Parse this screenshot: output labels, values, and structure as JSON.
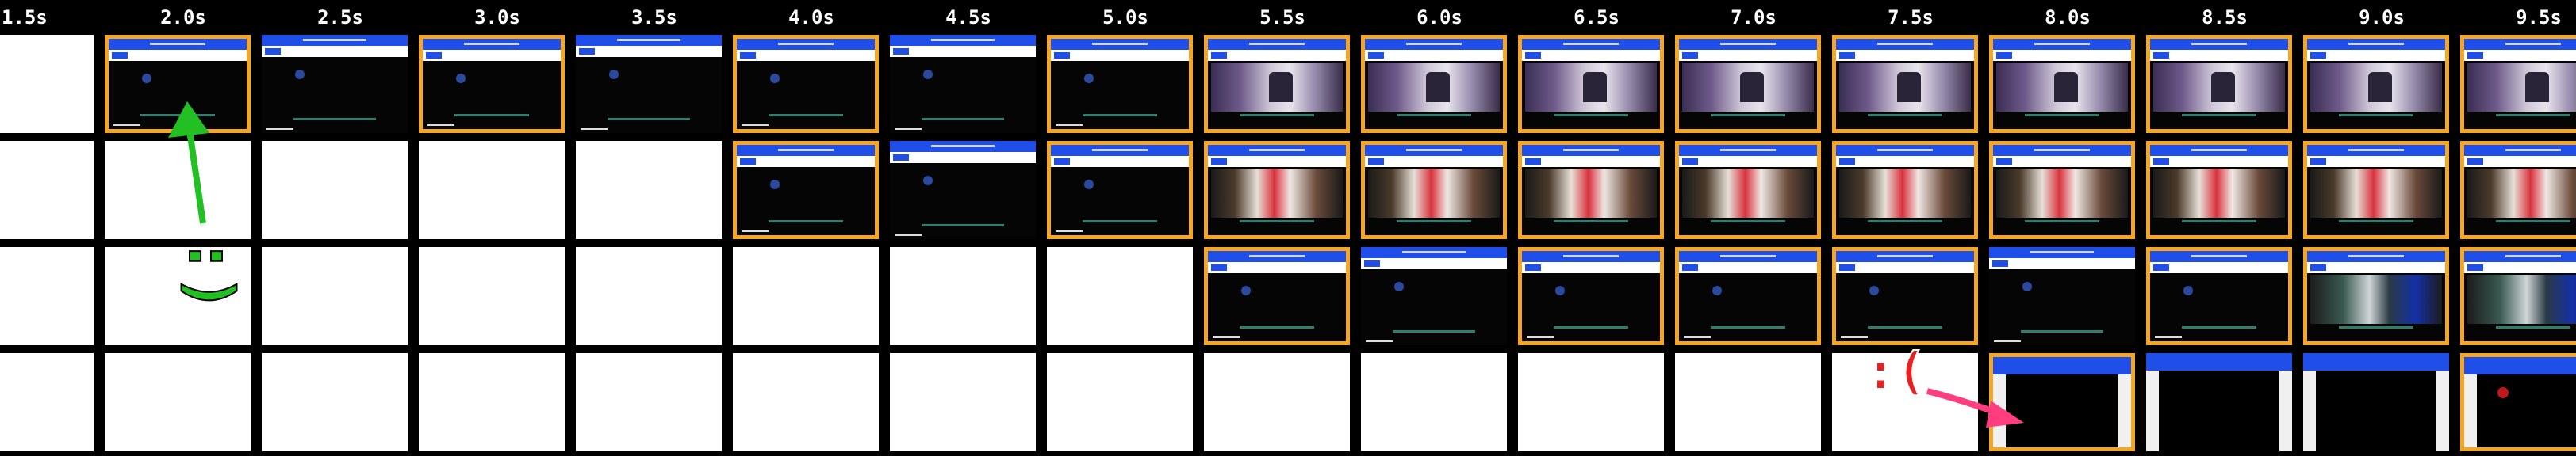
{
  "time_labels": [
    "1.5s",
    "2.0s",
    "2.5s",
    "3.0s",
    "3.5s",
    "4.0s",
    "4.5s",
    "5.0s",
    "5.5s",
    "6.0s",
    "6.5s",
    "7.0s",
    "7.5s",
    "8.0s",
    "8.5s",
    "9.0s",
    "9.5s"
  ],
  "rows": [
    {
      "name": "row-1",
      "frames": [
        "blank",
        "dark",
        "dark",
        "dark",
        "dark",
        "dark",
        "dark",
        "dark",
        "video",
        "video",
        "video",
        "video",
        "video",
        "video",
        "video",
        "video",
        "video"
      ],
      "changed": [
        false,
        true,
        false,
        true,
        false,
        true,
        false,
        true,
        true,
        true,
        true,
        true,
        true,
        true,
        true,
        true,
        true
      ]
    },
    {
      "name": "row-2",
      "frames": [
        "blank",
        "blank",
        "blank",
        "blank",
        "blank",
        "dark",
        "dark",
        "dark",
        "colorful",
        "colorful",
        "colorful",
        "colorful",
        "colorful",
        "colorful",
        "colorful",
        "colorful",
        "colorful"
      ],
      "changed": [
        false,
        false,
        false,
        false,
        false,
        true,
        false,
        true,
        true,
        true,
        true,
        true,
        true,
        true,
        true,
        true,
        true
      ]
    },
    {
      "name": "row-3",
      "frames": [
        "blank",
        "blank",
        "blank",
        "blank",
        "blank",
        "blank",
        "blank",
        "blank",
        "dark",
        "dark",
        "dark",
        "dark",
        "dark",
        "dark",
        "dark",
        "gallery",
        "gallery"
      ],
      "changed": [
        false,
        false,
        false,
        false,
        false,
        false,
        false,
        false,
        true,
        false,
        true,
        true,
        true,
        false,
        true,
        true,
        true
      ]
    },
    {
      "name": "row-4",
      "frames": [
        "blank",
        "blank",
        "blank",
        "blank",
        "blank",
        "blank",
        "blank",
        "blank",
        "blank",
        "blank",
        "blank",
        "blank",
        "blank",
        "tall",
        "tall",
        "tall",
        "tall-dot"
      ],
      "changed": [
        false,
        false,
        false,
        false,
        false,
        false,
        false,
        false,
        false,
        false,
        false,
        false,
        false,
        true,
        false,
        false,
        true
      ]
    }
  ],
  "annotations": {
    "happy_face": ":)",
    "sad_face": ":(",
    "green_color": "#22c022",
    "red_color": "#e82020",
    "pink_arrow_color": "#ff3d7f",
    "highlight_color": "#f5a623"
  }
}
